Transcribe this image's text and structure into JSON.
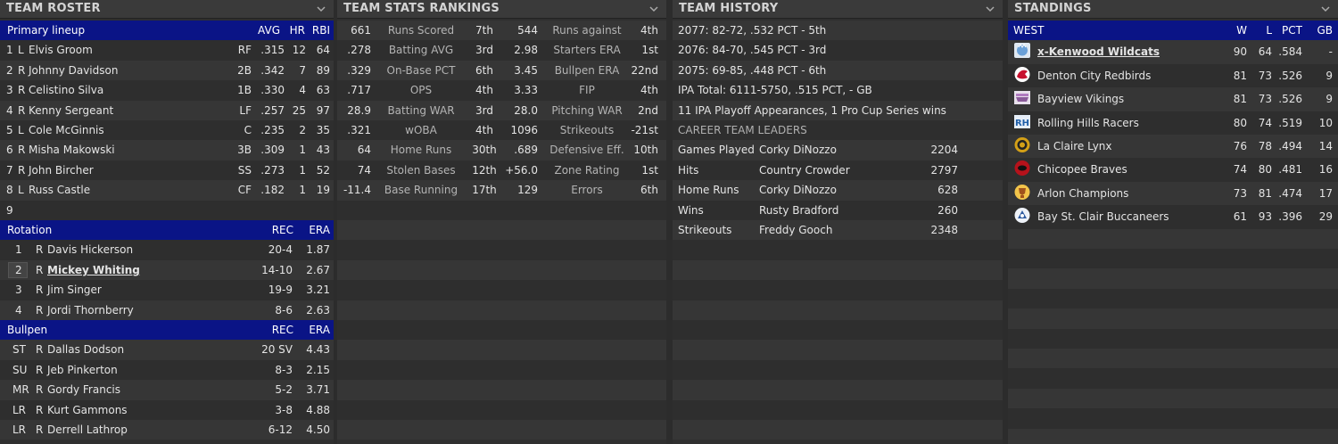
{
  "roster": {
    "title": "TEAM ROSTER",
    "lineup_header": {
      "label": "Primary lineup",
      "avg": "AVG",
      "hr": "HR",
      "rbi": "RBI"
    },
    "lineup": [
      {
        "num": "1",
        "hand": "L",
        "name": "Elvis Groom",
        "pos": "RF",
        "avg": ".315",
        "hr": "12",
        "rbi": "64"
      },
      {
        "num": "2",
        "hand": "R",
        "name": "Johnny Davidson",
        "pos": "2B",
        "avg": ".342",
        "hr": "7",
        "rbi": "89"
      },
      {
        "num": "3",
        "hand": "R",
        "name": "Celistino Silva",
        "pos": "1B",
        "avg": ".330",
        "hr": "4",
        "rbi": "63"
      },
      {
        "num": "4",
        "hand": "R",
        "name": "Kenny Sergeant",
        "pos": "LF",
        "avg": ".257",
        "hr": "25",
        "rbi": "97"
      },
      {
        "num": "5",
        "hand": "L",
        "name": "Cole McGinnis",
        "pos": "C",
        "avg": ".235",
        "hr": "2",
        "rbi": "35"
      },
      {
        "num": "6",
        "hand": "R",
        "name": "Misha Makowski",
        "pos": "3B",
        "avg": ".309",
        "hr": "1",
        "rbi": "43"
      },
      {
        "num": "7",
        "hand": "R",
        "name": "John Bircher",
        "pos": "SS",
        "avg": ".273",
        "hr": "1",
        "rbi": "52"
      },
      {
        "num": "8",
        "hand": "L",
        "name": "Russ Castle",
        "pos": "CF",
        "avg": ".182",
        "hr": "1",
        "rbi": "19"
      },
      {
        "num": "9",
        "hand": "",
        "name": "",
        "pos": "",
        "avg": "",
        "hr": "",
        "rbi": ""
      }
    ],
    "rotation_header": {
      "label": "Rotation",
      "rec": "REC",
      "era": "ERA"
    },
    "rotation": [
      {
        "num": "1",
        "hand": "R",
        "name": "Davis Hickerson",
        "rec": "20-4",
        "era": "1.87"
      },
      {
        "num": "2",
        "hand": "R",
        "name": "Mickey Whiting",
        "rec": "14-10",
        "era": "2.67"
      },
      {
        "num": "3",
        "hand": "R",
        "name": "Jim Singer",
        "rec": "19-9",
        "era": "3.21"
      },
      {
        "num": "4",
        "hand": "R",
        "name": "Jordi Thornberry",
        "rec": "8-6",
        "era": "2.63"
      }
    ],
    "bullpen_header": {
      "label": "Bullpen",
      "rec": "REC",
      "era": "ERA"
    },
    "bullpen": [
      {
        "role": "ST",
        "hand": "R",
        "name": "Dallas Dodson",
        "rec": "20 SV",
        "era": "4.43"
      },
      {
        "role": "SU",
        "hand": "R",
        "name": "Jeb Pinkerton",
        "rec": "8-3",
        "era": "2.15"
      },
      {
        "role": "MR",
        "hand": "R",
        "name": "Gordy Francis",
        "rec": "5-2",
        "era": "3.71"
      },
      {
        "role": "LR",
        "hand": "R",
        "name": "Kurt Gammons",
        "rec": "3-8",
        "era": "4.88"
      },
      {
        "role": "LR",
        "hand": "R",
        "name": "Derrell Lathrop",
        "rec": "6-12",
        "era": "4.50"
      }
    ]
  },
  "rankings": {
    "title": "TEAM STATS RANKINGS",
    "rows": [
      {
        "v1": "661",
        "l1": "Runs Scored",
        "r1": "7th",
        "v2": "544",
        "l2": "Runs against",
        "r2": "4th"
      },
      {
        "v1": ".278",
        "l1": "Batting AVG",
        "r1": "3rd",
        "v2": "2.98",
        "l2": "Starters ERA",
        "r2": "1st"
      },
      {
        "v1": ".329",
        "l1": "On-Base PCT",
        "r1": "6th",
        "v2": "3.45",
        "l2": "Bullpen ERA",
        "r2": "22nd"
      },
      {
        "v1": ".717",
        "l1": "OPS",
        "r1": "4th",
        "v2": "3.33",
        "l2": "FIP",
        "r2": "4th"
      },
      {
        "v1": "28.9",
        "l1": "Batting WAR",
        "r1": "3rd",
        "v2": "28.0",
        "l2": "Pitching WAR",
        "r2": "2nd"
      },
      {
        "v1": ".321",
        "l1": "wOBA",
        "r1": "4th",
        "v2": "1096",
        "l2": "Strikeouts",
        "r2": "-21st"
      },
      {
        "v1": "64",
        "l1": "Home Runs",
        "r1": "30th",
        "v2": ".689",
        "l2": "Defensive Eff.",
        "r2": "10th"
      },
      {
        "v1": "74",
        "l1": "Stolen Bases",
        "r1": "12th",
        "v2": "+56.0",
        "l2": "Zone Rating",
        "r2": "1st"
      },
      {
        "v1": "-11.4",
        "l1": "Base Running",
        "r1": "17th",
        "v2": "129",
        "l2": "Errors",
        "r2": "6th"
      }
    ]
  },
  "history": {
    "title": "TEAM HISTORY",
    "lines": [
      "2077: 82-72, .532 PCT - 5th",
      "2076: 84-70, .545 PCT - 3rd",
      "2075: 69-85, .448 PCT - 6th",
      "IPA Total: 6111-5750, .515 PCT, - GB",
      "11 IPA Playoff Appearances, 1 Pro Cup Series wins"
    ],
    "leaders_title": "CAREER TEAM LEADERS",
    "leaders": [
      {
        "cat": "Games Played",
        "name": "Corky DiNozzo",
        "val": "2204"
      },
      {
        "cat": "Hits",
        "name": "Country Crowder",
        "val": "2797"
      },
      {
        "cat": "Home Runs",
        "name": "Corky DiNozzo",
        "val": "628"
      },
      {
        "cat": "Wins",
        "name": "Rusty Bradford",
        "val": "260"
      },
      {
        "cat": "Strikeouts",
        "name": "Freddy Gooch",
        "val": "2348"
      }
    ]
  },
  "standings": {
    "title": "STANDINGS",
    "header": {
      "division": "WEST",
      "w": "W",
      "l": "L",
      "pct": "PCT",
      "gb": "GB"
    },
    "teams": [
      {
        "name": "x-Kenwood Wildcats",
        "w": "90",
        "l": "64",
        "pct": ".584",
        "gb": "-",
        "logo": "wildcat-logo-icon",
        "color": "#9cc2e6"
      },
      {
        "name": "Denton City Redbirds",
        "w": "81",
        "l": "73",
        "pct": ".526",
        "gb": "9",
        "logo": "redbird-logo-icon",
        "color": "#c8102e"
      },
      {
        "name": "Bayview Vikings",
        "w": "81",
        "l": "73",
        "pct": ".526",
        "gb": "9",
        "logo": "viking-logo-icon",
        "color": "#8a5a9a"
      },
      {
        "name": "Rolling Hills Racers",
        "w": "80",
        "l": "74",
        "pct": ".519",
        "gb": "10",
        "logo": "racers-logo-icon",
        "color": "#1f5fa8"
      },
      {
        "name": "La Claire Lynx",
        "w": "76",
        "l": "78",
        "pct": ".494",
        "gb": "14",
        "logo": "lynx-logo-icon",
        "color": "#d4a017"
      },
      {
        "name": "Chicopee Braves",
        "w": "74",
        "l": "80",
        "pct": ".481",
        "gb": "16",
        "logo": "braves-logo-icon",
        "color": "#b5121b"
      },
      {
        "name": "Arlon Champions",
        "w": "73",
        "l": "81",
        "pct": ".474",
        "gb": "17",
        "logo": "champions-logo-icon",
        "color": "#e0a020"
      },
      {
        "name": "Bay St. Clair Buccaneers",
        "w": "61",
        "l": "93",
        "pct": ".396",
        "gb": "29",
        "logo": "buccaneers-logo-icon",
        "color": "#2d5aa0"
      }
    ]
  },
  "colors": {
    "section_header": "#0a1486",
    "panel_bg": "#2f2f2f",
    "row_alt": "#363636"
  }
}
